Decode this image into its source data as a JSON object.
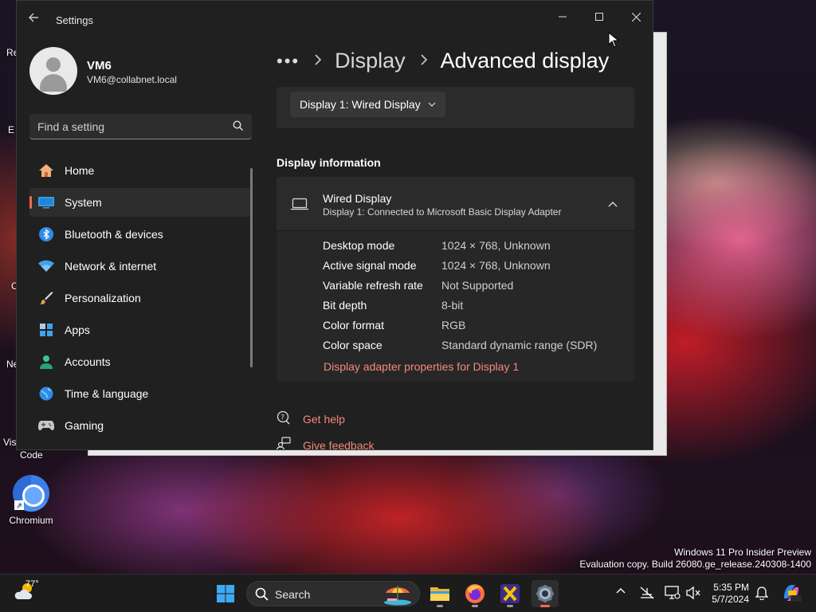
{
  "desktop": {
    "fragments": [
      "Re",
      "E",
      "C",
      "Ne",
      "Vis"
    ],
    "vscode_label": "Code",
    "chromium_label": "Chromium",
    "watermark": {
      "line1": "Windows 11 Pro Insider Preview",
      "line2": "Evaluation copy. Build 26080.ge_release.240308-1400"
    }
  },
  "window": {
    "title": "Settings"
  },
  "profile": {
    "name": "VM6",
    "email": "VM6@collabnet.local"
  },
  "search": {
    "placeholder": "Find a setting"
  },
  "nav": {
    "items": [
      {
        "label": "Home",
        "icon": "home-icon"
      },
      {
        "label": "System",
        "icon": "system-icon"
      },
      {
        "label": "Bluetooth & devices",
        "icon": "bluetooth-icon"
      },
      {
        "label": "Network & internet",
        "icon": "wifi-icon"
      },
      {
        "label": "Personalization",
        "icon": "brush-icon"
      },
      {
        "label": "Apps",
        "icon": "apps-icon"
      },
      {
        "label": "Accounts",
        "icon": "accounts-icon"
      },
      {
        "label": "Time & language",
        "icon": "globe-icon"
      },
      {
        "label": "Gaming",
        "icon": "gamepad-icon"
      }
    ],
    "active_index": 1
  },
  "breadcrumb": {
    "dots": "•••",
    "parent": "Display",
    "current": "Advanced display"
  },
  "display_select": {
    "value": "Display 1: Wired Display"
  },
  "display_info": {
    "section_title": "Display information",
    "title": "Wired Display",
    "subtitle": "Display 1: Connected to Microsoft Basic Display Adapter",
    "rows": [
      {
        "key": "Desktop mode",
        "value": "1024 × 768, Unknown"
      },
      {
        "key": "Active signal mode",
        "value": "1024 × 768, Unknown"
      },
      {
        "key": "Variable refresh rate",
        "value": "Not Supported"
      },
      {
        "key": "Bit depth",
        "value": "8-bit"
      },
      {
        "key": "Color format",
        "value": "RGB"
      },
      {
        "key": "Color space",
        "value": "Standard dynamic range (SDR)"
      }
    ],
    "adapter_link": "Display adapter properties for Display 1"
  },
  "help": {
    "get_help": "Get help",
    "give_feedback": "Give feedback"
  },
  "taskbar": {
    "weather_temp": "77°",
    "search_label": "Search",
    "time": "5:35 PM",
    "date": "5/7/2024"
  },
  "colors": {
    "accent": "#f06a52",
    "link": "#f5897a",
    "window_bg": "#202020",
    "card_bg": "#2b2b2b"
  }
}
